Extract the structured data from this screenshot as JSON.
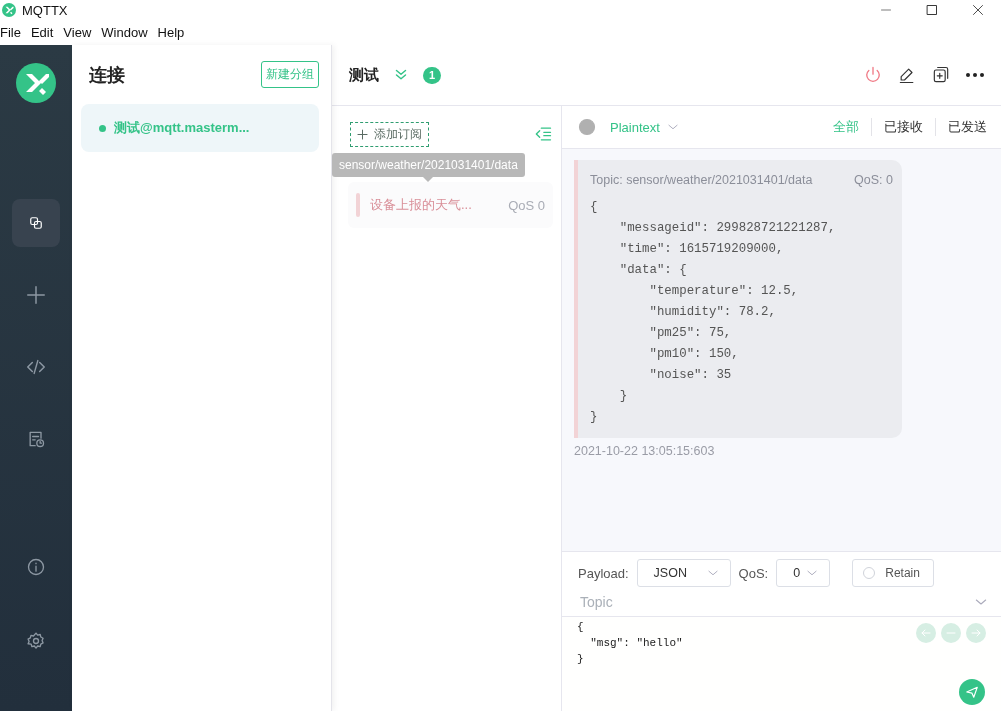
{
  "window": {
    "title": "MQTTX"
  },
  "menu": [
    "File",
    "Edit",
    "View",
    "Window",
    "Help"
  ],
  "nav": [
    {
      "kind": "connections",
      "selected": true
    },
    {
      "kind": "new",
      "selected": false
    },
    {
      "kind": "script",
      "selected": false
    },
    {
      "kind": "log",
      "selected": false
    },
    {
      "kind": "about",
      "selected": false
    },
    {
      "kind": "settings",
      "selected": false
    }
  ],
  "connections": {
    "title": "连接",
    "new_group_button": "新建分组",
    "items": [
      {
        "name": "测试@mqtt.masterm...",
        "online": true,
        "selected": true
      }
    ]
  },
  "connection": {
    "name": "测试",
    "unread": "1"
  },
  "subscriptions": {
    "add_button": "添加订阅",
    "tooltip": "sensor/weather/2021031401/data",
    "items": [
      {
        "alias": "设备上报的天气...",
        "qos": "QoS 0",
        "color": "#f2d3d6"
      }
    ]
  },
  "messages": {
    "format": "Plaintext",
    "filters": [
      {
        "label": "全部",
        "selected": true
      },
      {
        "label": "已接收",
        "selected": false
      },
      {
        "label": "已发送",
        "selected": false
      }
    ],
    "items": [
      {
        "topic": "Topic: sensor/weather/2021031401/data",
        "qos": "QoS: 0",
        "payload": "{\n    \"messageid\": 299828721221287,\n    \"time\": 1615719209000,\n    \"data\": {\n        \"temperature\": 12.5,\n        \"humidity\": 78.2,\n        \"pm25\": 75,\n        \"pm10\": 150,\n        \"noise\": 35\n    }\n}",
        "time": "2021-10-22 13:05:15:603"
      }
    ]
  },
  "composer": {
    "payload_label": "Payload:",
    "payload_format": "JSON",
    "qos_label": "QoS:",
    "qos": "0",
    "retain": {
      "label": "Retain",
      "checked": false
    },
    "topic_placeholder": "Topic",
    "editor_lines": [
      "{",
      "  \"msg\": \"hello\"",
      "}"
    ]
  }
}
